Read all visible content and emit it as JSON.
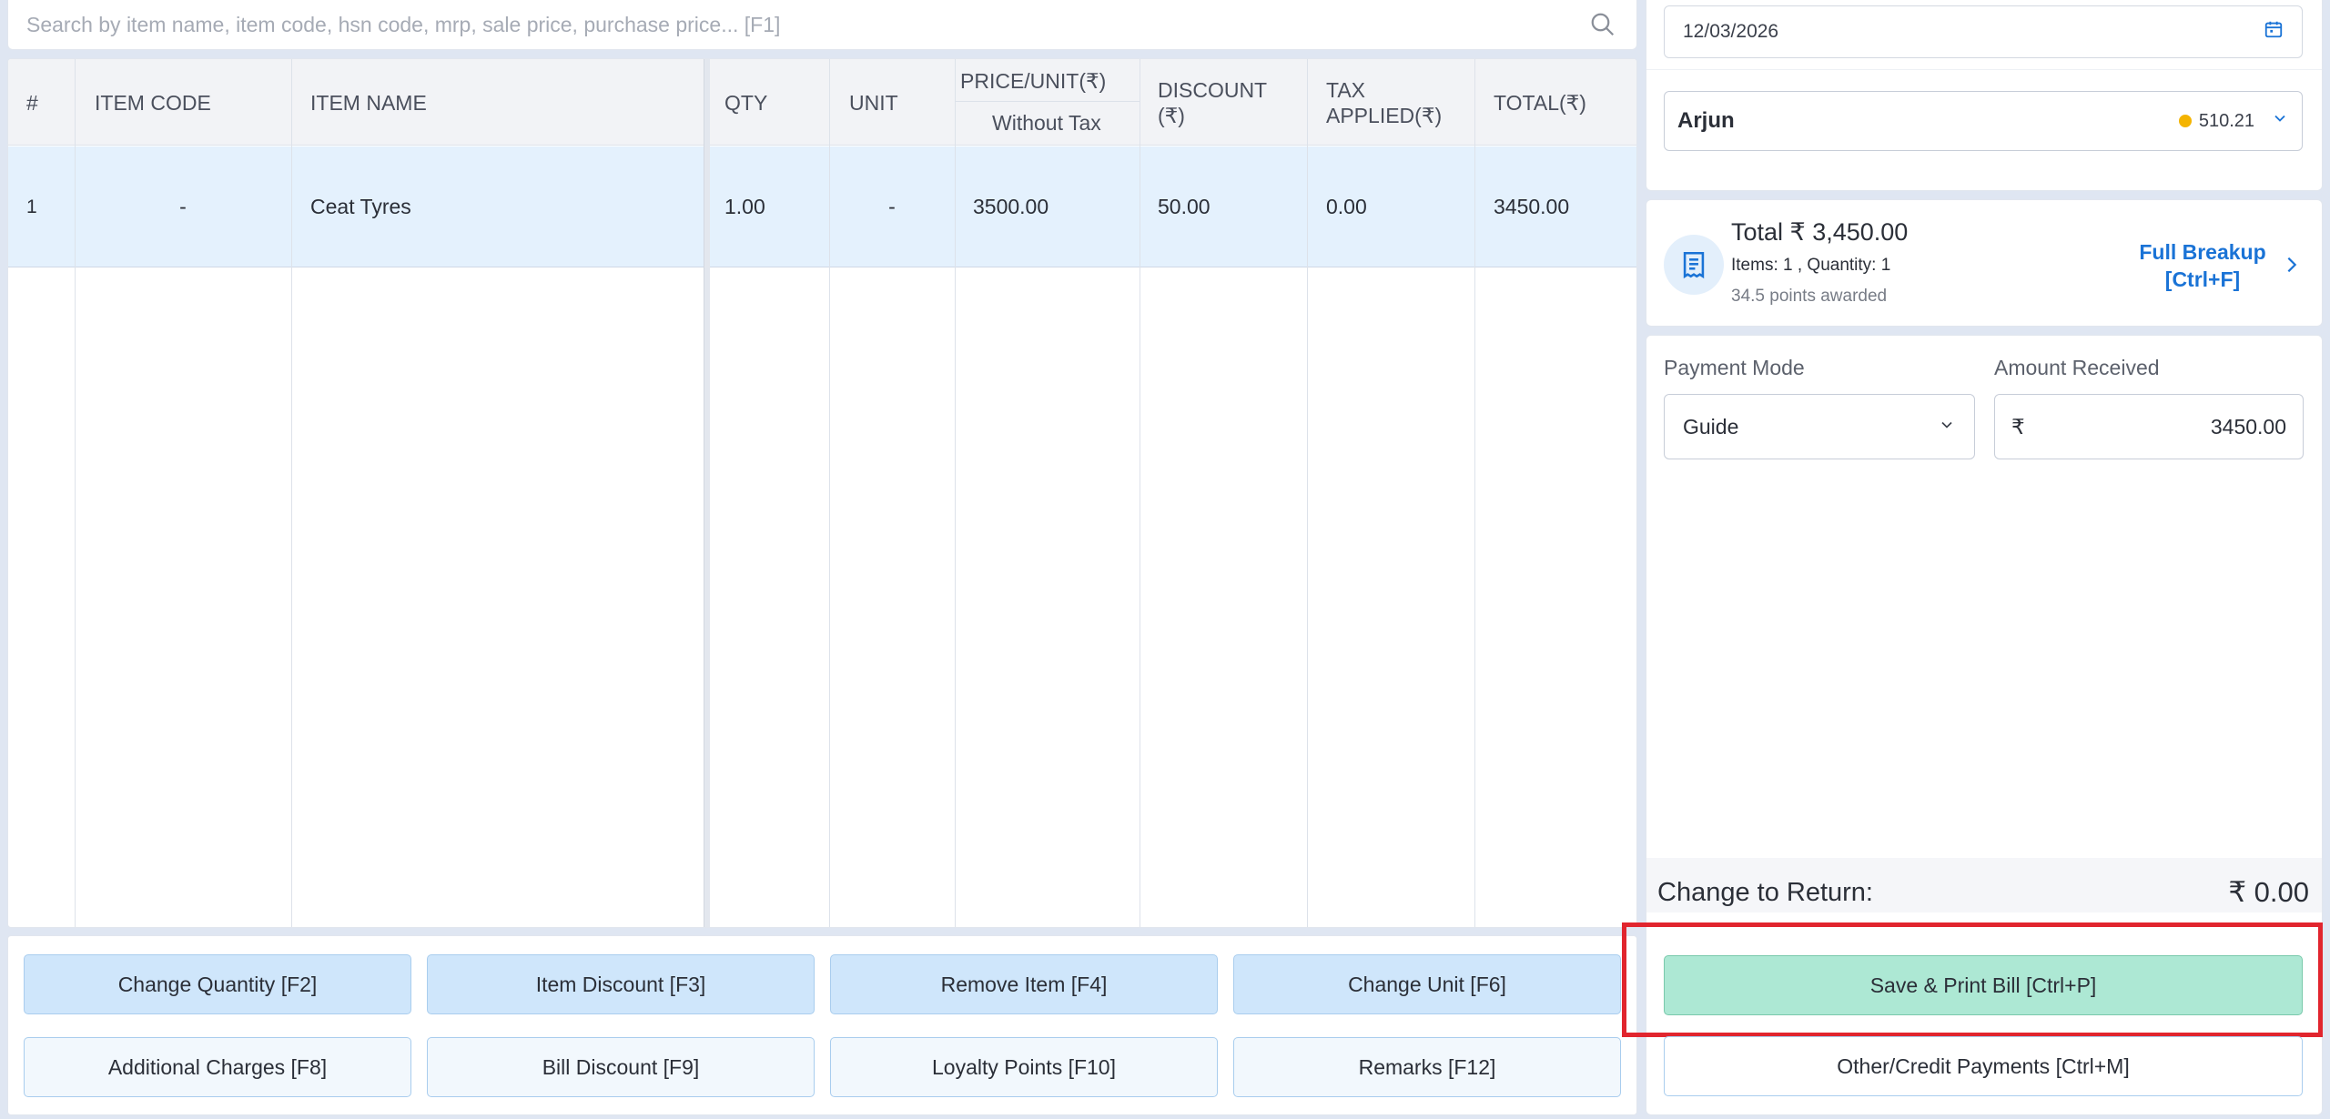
{
  "search": {
    "placeholder": "Search by item name, item code, hsn code, mrp, sale price, purchase price... [F1]"
  },
  "table": {
    "headers": {
      "index": "#",
      "item_code": "ITEM CODE",
      "item_name": "ITEM NAME",
      "qty": "QTY",
      "unit": "UNIT",
      "price": "PRICE/UNIT(₹)",
      "price_sub": "Without Tax",
      "discount_1": "DISCOUNT",
      "discount_2": "(₹)",
      "tax_1": "TAX",
      "tax_2": "APPLIED(₹)",
      "total": "TOTAL(₹)"
    },
    "rows": [
      {
        "index": "1",
        "item_code": "-",
        "item_name": "Ceat Tyres",
        "qty": "1.00",
        "unit": "-",
        "price": "3500.00",
        "discount": "50.00",
        "tax": "0.00",
        "total": "3450.00"
      }
    ]
  },
  "actions": {
    "change_quantity": "Change Quantity [F2]",
    "item_discount": "Item Discount [F3]",
    "remove_item": "Remove Item [F4]",
    "change_unit": "Change Unit [F6]",
    "additional_charges": "Additional Charges [F8]",
    "bill_discount": "Bill Discount [F9]",
    "loyalty_points": "Loyalty Points [F10]",
    "remarks": "Remarks [F12]"
  },
  "invoice": {
    "date": "12/03/2026",
    "customer_name": "Arjun",
    "customer_points": "510.21"
  },
  "summary": {
    "total": "Total ₹ 3,450.00",
    "items": "Items: 1 , Quantity: 1",
    "points": "34.5 points awarded",
    "breakup_1": "Full Breakup",
    "breakup_2": "[Ctrl+F]"
  },
  "payment": {
    "mode_label": "Payment Mode",
    "mode_value": "Guide",
    "amount_label": "Amount Received",
    "currency": "₹",
    "amount_value": "3450.00",
    "change_label": "Change to Return:",
    "change_value": "₹ 0.00"
  },
  "footer": {
    "save_print": "Save & Print Bill [Ctrl+P]",
    "other_payments": "Other/Credit Payments [Ctrl+M]"
  },
  "colors": {
    "accent": "#1a73d6",
    "save_button": "#ade8d4",
    "highlight": "#e1252e",
    "selected_row": "#e4f1fd"
  }
}
